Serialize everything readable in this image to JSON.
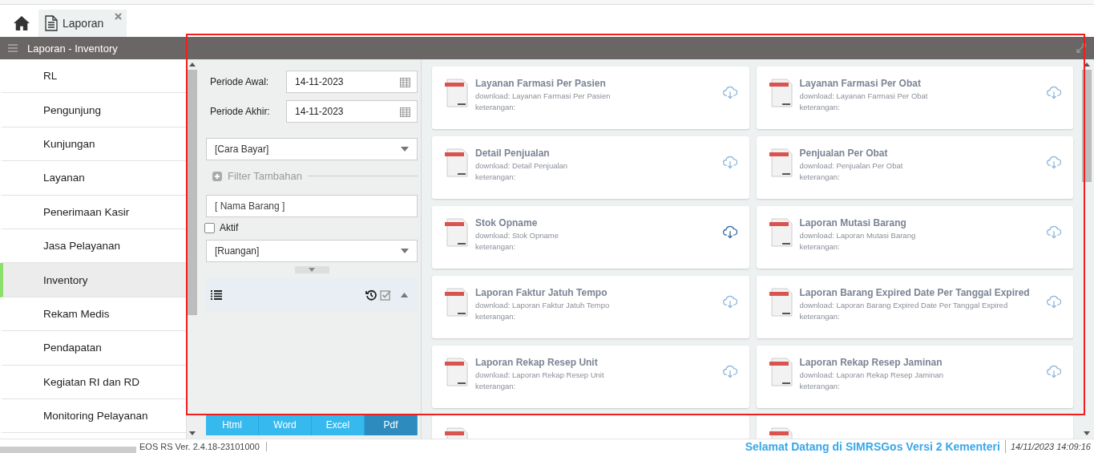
{
  "tabs": [
    {
      "label": "Laporan",
      "selected": true
    }
  ],
  "header": {
    "title": "Laporan - Inventory"
  },
  "sidebar": {
    "items": [
      {
        "label": "RL",
        "selected": false
      },
      {
        "label": "Pengunjung",
        "selected": false
      },
      {
        "label": "Kunjungan",
        "selected": false
      },
      {
        "label": "Layanan",
        "selected": false
      },
      {
        "label": "Penerimaan Kasir",
        "selected": false
      },
      {
        "label": "Jasa Pelayanan",
        "selected": false
      },
      {
        "label": "Inventory",
        "selected": true
      },
      {
        "label": "Rekam Medis",
        "selected": false
      },
      {
        "label": "Pendapatan",
        "selected": false
      },
      {
        "label": "Kegiatan RI dan RD",
        "selected": false
      },
      {
        "label": "Monitoring Pelayanan",
        "selected": false
      }
    ]
  },
  "filters": {
    "periode_awal": {
      "label": "Periode Awal:",
      "value": "14-11-2023"
    },
    "periode_akhir": {
      "label": "Periode Akhir:",
      "value": "14-11-2023"
    },
    "cara_bayar": {
      "value": "[Cara Bayar]"
    },
    "filter_tambahan": "Filter Tambahan",
    "nama_barang": {
      "placeholder": "[ Nama Barang ]"
    },
    "aktif": {
      "label": "Aktif",
      "checked": false
    },
    "ruangan": {
      "value": "[Ruangan]"
    }
  },
  "export_buttons": [
    {
      "label": "Html",
      "selected": false
    },
    {
      "label": "Word",
      "selected": false
    },
    {
      "label": "Excel",
      "selected": false
    },
    {
      "label": "Pdf",
      "selected": true
    }
  ],
  "reports": [
    {
      "title": "Layanan Farmasi Per Pasien",
      "download": "download: Layanan Farmasi Per Pasien",
      "note": "keterangan:",
      "active": false
    },
    {
      "title": "Layanan Farmasi Per Obat",
      "download": "download: Layanan Farmasi Per Obat",
      "note": "keterangan:",
      "active": false
    },
    {
      "title": "Detail Penjualan",
      "download": "download: Detail Penjualan",
      "note": "keterangan:",
      "active": false
    },
    {
      "title": "Penjualan Per Obat",
      "download": "download: Penjualan Per Obat",
      "note": "keterangan:",
      "active": false
    },
    {
      "title": "Stok Opname",
      "download": "download: Stok Opname",
      "note": "keterangan:",
      "active": true
    },
    {
      "title": "Laporan Mutasi Barang",
      "download": "download: Laporan Mutasi Barang",
      "note": "keterangan:",
      "active": false
    },
    {
      "title": "Laporan Faktur Jatuh Tempo",
      "download": "download: Laporan Faktur Jatuh Tempo",
      "note": "keterangan:",
      "active": false
    },
    {
      "title": "Laporan Barang Expired Date Per Tanggal Expired",
      "download": "download: Laporan Barang Expired Date Per Tanggal Expired",
      "note": "keterangan:",
      "active": false
    },
    {
      "title": "Laporan Rekap Resep Unit",
      "download": "download: Laporan Rekap Resep Unit",
      "note": "keterangan:",
      "active": false
    },
    {
      "title": "Laporan Rekap Resep Jaminan",
      "download": "download: Laporan Rekap Resep Jaminan",
      "note": "keterangan:",
      "active": false
    }
  ],
  "status_bar": {
    "version": "EOS RS Ver. 2.4.18-23101000",
    "welcome": "Selamat Datang di SIMRSGos Versi 2 Kementeri",
    "datetime": "14/11/2023 14:09:16"
  }
}
